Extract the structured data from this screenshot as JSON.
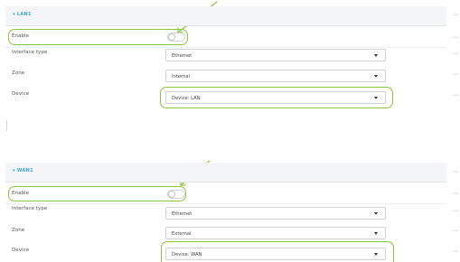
{
  "sections": [
    {
      "title": "▾ LAN1",
      "rows": {
        "enable": {
          "label": "Enable"
        },
        "interface_type": {
          "label": "Interface type",
          "value": "Ethernet"
        },
        "zone": {
          "label": "Zone",
          "value": "Internal"
        },
        "device": {
          "label": "Device",
          "value": "Device: LAN"
        }
      }
    },
    {
      "title": "▾ WAN1",
      "rows": {
        "enable": {
          "label": "Enable"
        },
        "interface_type": {
          "label": "Interface type",
          "value": "Ethernet"
        },
        "zone": {
          "label": "Zone",
          "value": "External"
        },
        "device": {
          "label": "Device",
          "value": "Device: WAN"
        }
      }
    }
  ],
  "row_menu_label": "⋯",
  "colors": {
    "accent": "#3ba3d8",
    "highlight": "#8cc63f"
  }
}
